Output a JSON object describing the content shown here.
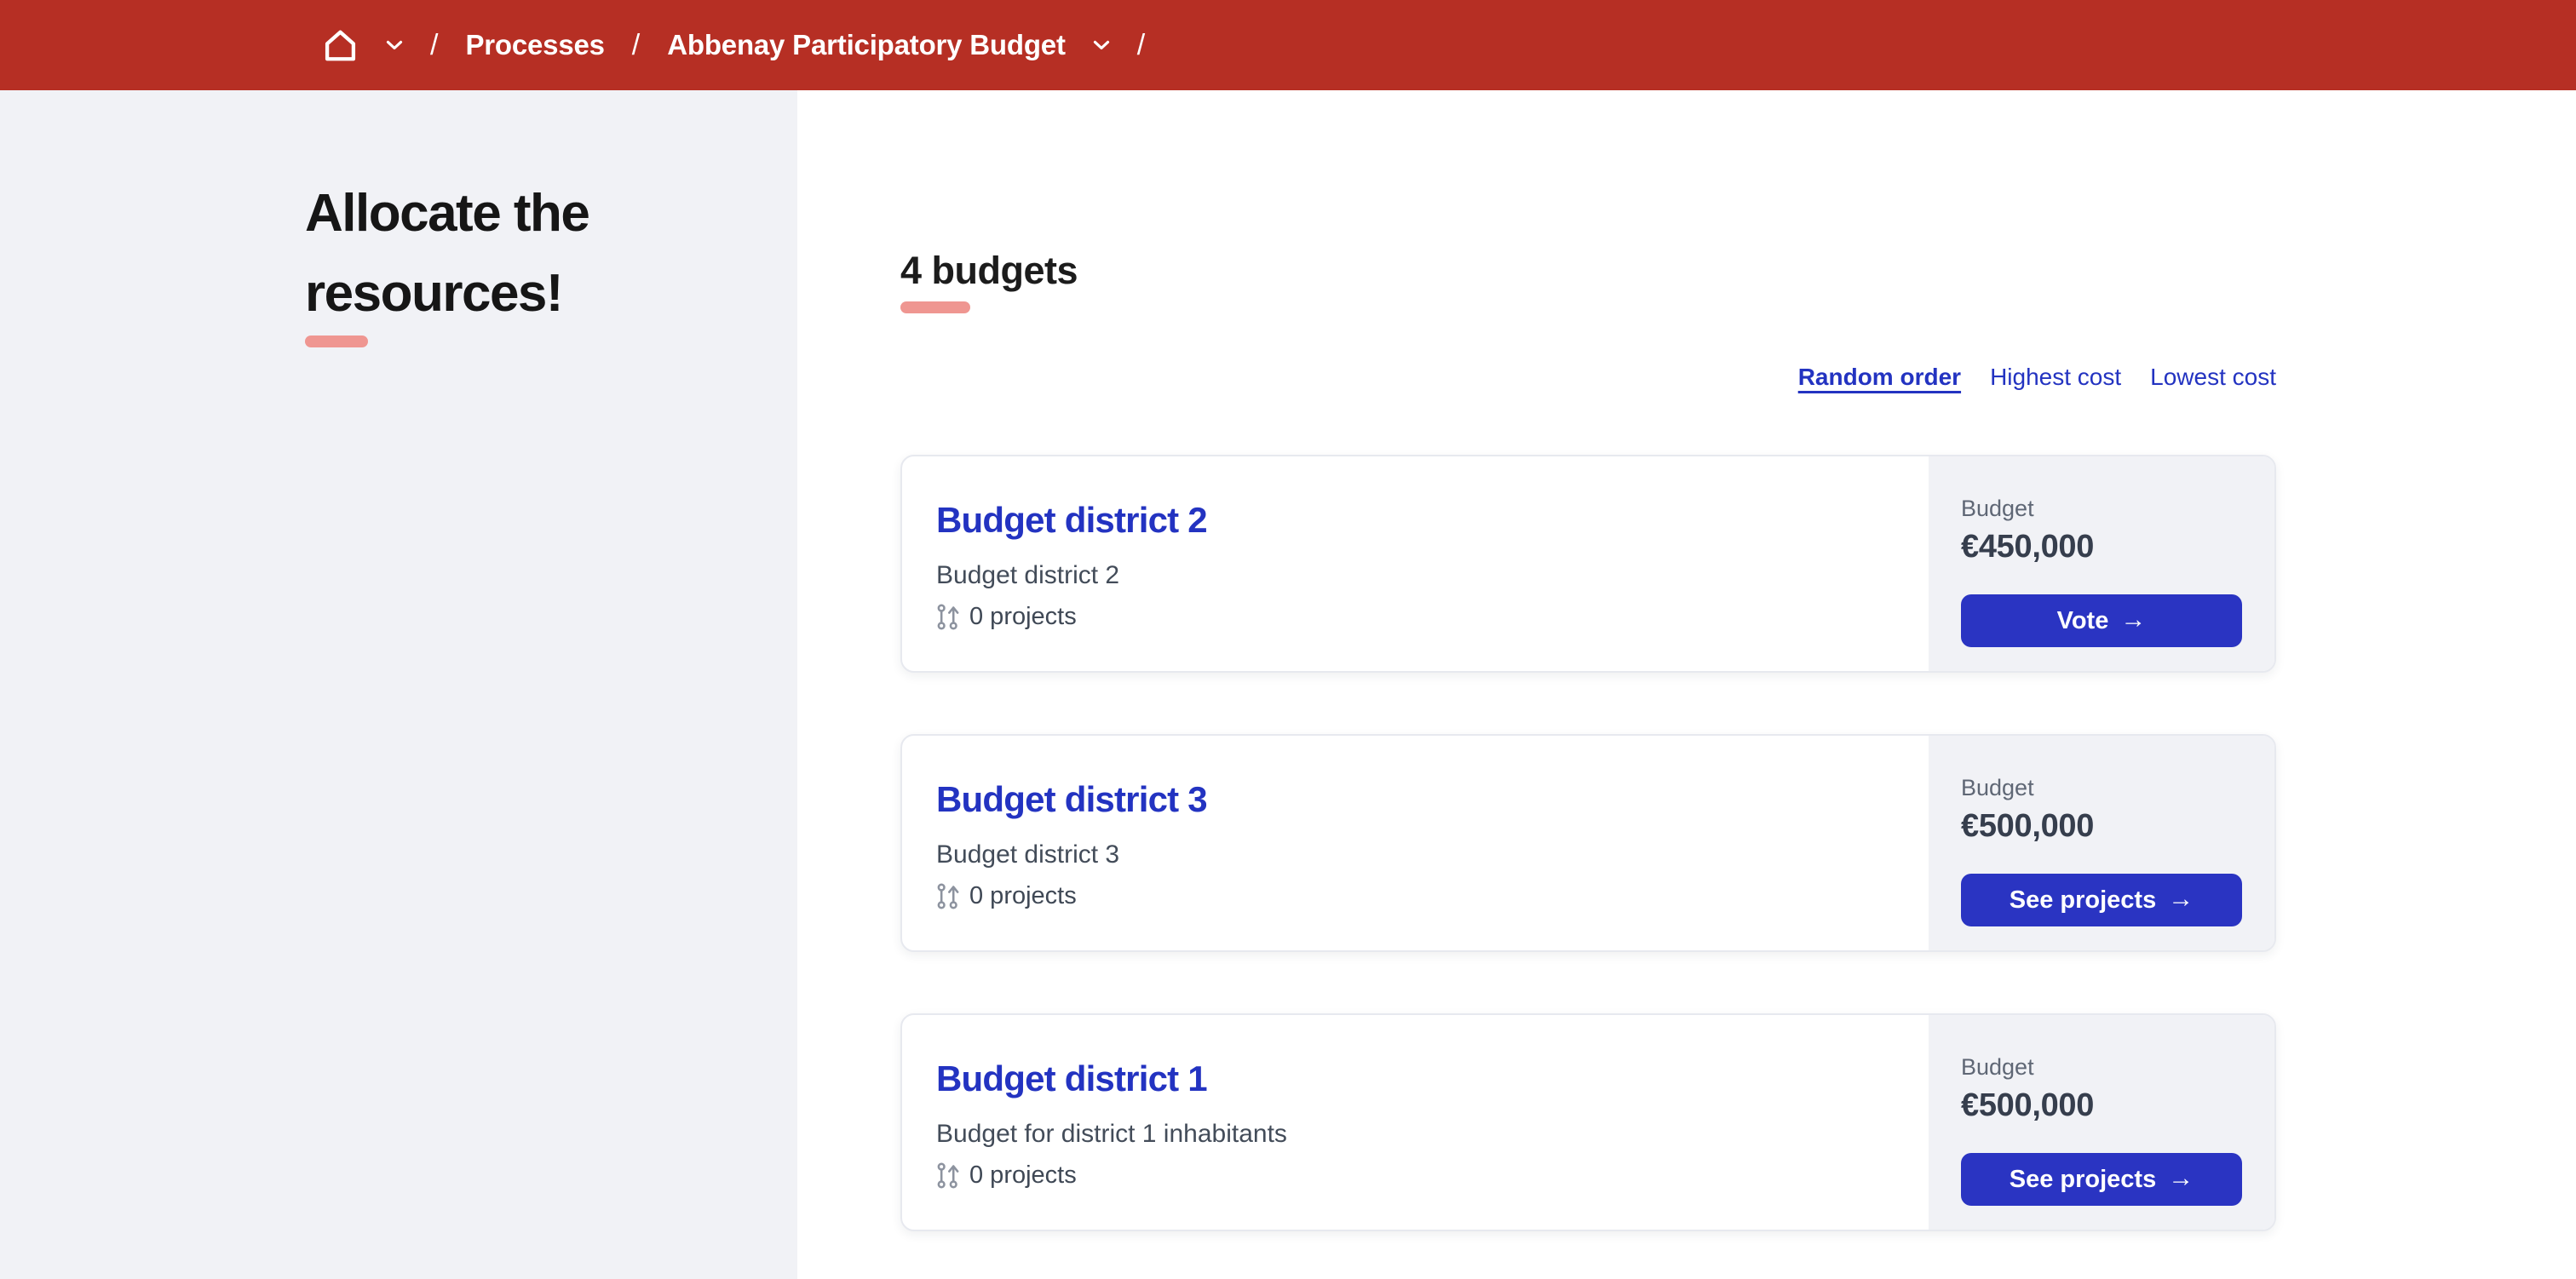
{
  "topbar": {
    "separator": "/",
    "breadcrumb": {
      "processes": "Processes",
      "process_title": "Abbenay Participatory Budget"
    }
  },
  "sidebar": {
    "heading_lines": [
      "Allocate the",
      "resources!"
    ]
  },
  "main": {
    "heading": "4 budgets",
    "sort": {
      "random": "Random order",
      "highest": "Highest cost",
      "lowest": "Lowest cost"
    },
    "budget_label": "Budget",
    "cta_arrow": "→",
    "cards": [
      {
        "title": "Budget district 2",
        "subtitle": "Budget district 2",
        "projects": "0 projects",
        "amount": "€450,000",
        "cta": "Vote"
      },
      {
        "title": "Budget district 3",
        "subtitle": "Budget district 3",
        "projects": "0 projects",
        "amount": "€500,000",
        "cta": "See projects"
      },
      {
        "title": "Budget district 1",
        "subtitle": "Budget for district 1 inhabitants",
        "projects": "0 projects",
        "amount": "€500,000",
        "cta": "See projects"
      }
    ]
  },
  "colors": {
    "topbar_red": "#b62f24",
    "accent_blue": "#2333c1",
    "button_blue": "#2a34c2",
    "underline_salmon": "#ef9691",
    "panel_gray": "#f1f2f6"
  }
}
